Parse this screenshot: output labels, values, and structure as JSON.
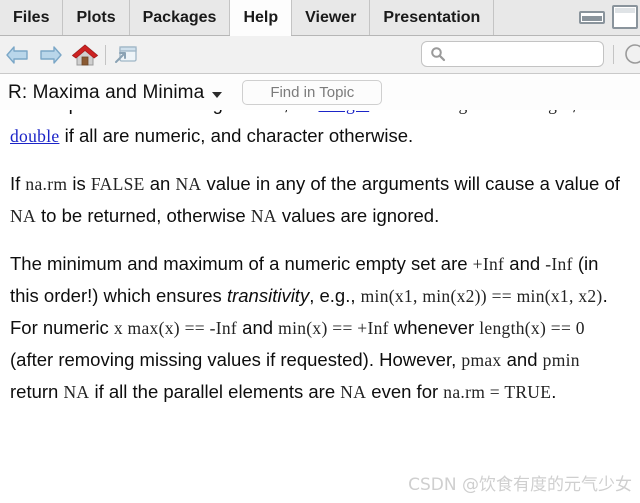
{
  "window": {
    "tabs": [
      {
        "label": "Files",
        "active": false
      },
      {
        "label": "Plots",
        "active": false
      },
      {
        "label": "Packages",
        "active": false
      },
      {
        "label": "Help",
        "active": true
      },
      {
        "label": "Viewer",
        "active": false
      },
      {
        "label": "Presentation",
        "active": false
      }
    ],
    "controls": {
      "minimize_label": "minimize-icon",
      "maximize_label": "maximize-icon"
    }
  },
  "toolbar": {
    "back_icon": "back-arrow-icon",
    "forward_icon": "forward-arrow-icon",
    "home_icon": "home-icon",
    "popout_icon": "show-in-new-window-icon",
    "search": {
      "icon": "search-icon",
      "value": "",
      "placeholder": ""
    }
  },
  "topicbar": {
    "title": "R: Maxima and Minima",
    "dropdown_icon": "chevron-down-icon",
    "find": {
      "value": "",
      "placeholder": "Find in Topic"
    }
  },
  "help_document": {
    "paragraphs": [
      {
        "id": "p-return-value",
        "clipped_top": true,
        "runs": [
          {
            "t": "text",
            "v": "values present in their arguments, as "
          },
          {
            "t": "link",
            "v": "integer"
          },
          {
            "t": "text",
            "v": " if all are "
          },
          {
            "t": "code",
            "v": "logical"
          },
          {
            "t": "text",
            "v": " or "
          },
          {
            "t": "code",
            "v": "integer"
          },
          {
            "t": "text",
            "v": ", as "
          },
          {
            "t": "link",
            "v": "double"
          },
          {
            "t": "text",
            "v": " if all are numeric, and character otherwise."
          }
        ]
      },
      {
        "id": "p-na-rm",
        "runs": [
          {
            "t": "text",
            "v": "If "
          },
          {
            "t": "code",
            "v": "na.rm"
          },
          {
            "t": "text",
            "v": " is "
          },
          {
            "t": "code",
            "v": "FALSE"
          },
          {
            "t": "text",
            "v": " an "
          },
          {
            "t": "code",
            "v": "NA"
          },
          {
            "t": "text",
            "v": " value in any of the arguments will cause a value of "
          },
          {
            "t": "code",
            "v": "NA"
          },
          {
            "t": "text",
            "v": " to be returned, otherwise "
          },
          {
            "t": "code",
            "v": "NA"
          },
          {
            "t": "text",
            "v": " values are ignored."
          }
        ]
      },
      {
        "id": "p-empty-set",
        "runs": [
          {
            "t": "text",
            "v": "The minimum and maximum of a numeric empty set are "
          },
          {
            "t": "code",
            "v": "+Inf"
          },
          {
            "t": "text",
            "v": " and "
          },
          {
            "t": "code",
            "v": "-Inf"
          },
          {
            "t": "text",
            "v": " (in this order!) which ensures "
          },
          {
            "t": "em",
            "v": "transitivity"
          },
          {
            "t": "text",
            "v": ", e.g., "
          },
          {
            "t": "code",
            "v": "min(x1, min(x2)) == min(x1, x2)"
          },
          {
            "t": "text",
            "v": ". For numeric "
          },
          {
            "t": "code",
            "v": "x max(x) == -Inf"
          },
          {
            "t": "text",
            "v": " and "
          },
          {
            "t": "code",
            "v": "min(x) == +Inf"
          },
          {
            "t": "text",
            "v": " whenever "
          },
          {
            "t": "code",
            "v": "length(x) == 0"
          },
          {
            "t": "text",
            "v": " (after removing missing values if requested). However, "
          },
          {
            "t": "code",
            "v": "pmax"
          },
          {
            "t": "text",
            "v": " and "
          },
          {
            "t": "code",
            "v": "pmin"
          },
          {
            "t": "text",
            "v": " return "
          },
          {
            "t": "code",
            "v": "NA"
          },
          {
            "t": "text",
            "v": " if all the parallel elements are "
          },
          {
            "t": "code",
            "v": "NA"
          },
          {
            "t": "text",
            "v": " even for "
          },
          {
            "t": "code",
            "v": "na.rm = TRUE"
          },
          {
            "t": "text",
            "v": "."
          }
        ]
      }
    ]
  },
  "watermark": {
    "text": "CSDN @饮食有度的元气少女"
  },
  "colors": {
    "link": "#1b24c7",
    "tabbar_bg": "#e8e8e8",
    "active_tab_bg": "#fdfdfd",
    "toolbar_bg": "#f1f1f1",
    "content_bg": "#ffffff",
    "home_roof": "#cc2222",
    "watermark": "#cfcfcf"
  }
}
